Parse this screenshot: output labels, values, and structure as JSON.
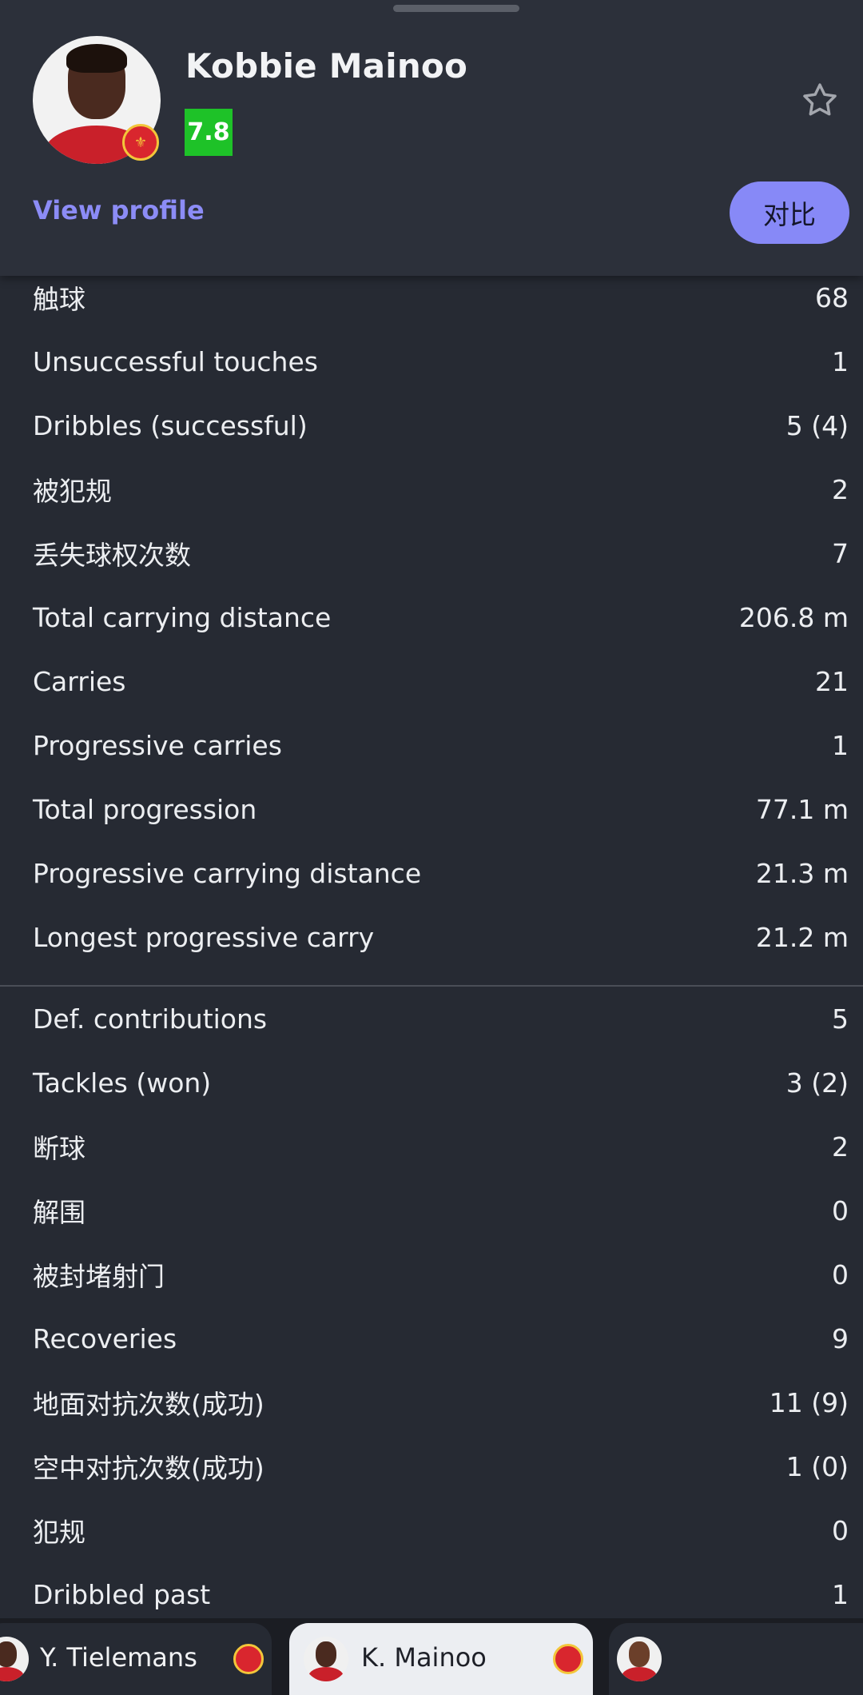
{
  "header": {
    "player_name": "Kobbie Mainoo",
    "rating": "7.8",
    "view_profile_label": "View profile",
    "compare_label": "对比",
    "favorite_icon": "star-outline-icon"
  },
  "stats_group_1": [
    {
      "label": "触球",
      "value": "68"
    },
    {
      "label": "Unsuccessful touches",
      "value": "1"
    },
    {
      "label": "Dribbles (successful)",
      "value": "5 (4)"
    },
    {
      "label": "被犯规",
      "value": "2"
    },
    {
      "label": "丢失球权次数",
      "value": "7"
    },
    {
      "label": "Total carrying distance",
      "value": "206.8 m"
    },
    {
      "label": "Carries",
      "value": "21"
    },
    {
      "label": "Progressive carries",
      "value": "1"
    },
    {
      "label": "Total progression",
      "value": "77.1 m"
    },
    {
      "label": "Progressive carrying distance",
      "value": "21.3 m"
    },
    {
      "label": "Longest progressive carry",
      "value": "21.2 m"
    }
  ],
  "stats_group_2": [
    {
      "label": "Def. contributions",
      "value": "5"
    },
    {
      "label": "Tackles (won)",
      "value": "3 (2)"
    },
    {
      "label": "断球",
      "value": "2"
    },
    {
      "label": "解围",
      "value": "0"
    },
    {
      "label": "被封堵射门",
      "value": "0"
    },
    {
      "label": "Recoveries",
      "value": "9"
    },
    {
      "label": "地面对抗次数(成功)",
      "value": "11 (9)"
    },
    {
      "label": "空中对抗次数(成功)",
      "value": "1 (0)"
    },
    {
      "label": "犯规",
      "value": "0"
    },
    {
      "label": "Dribbled past",
      "value": "1"
    }
  ],
  "player_tabs": [
    {
      "name": "Y. Tielemans"
    },
    {
      "name": "K. Mainoo"
    },
    {
      "name": ""
    }
  ],
  "colors": {
    "accent": "#8789f7",
    "rating": "#1ec228",
    "background": "#262a33",
    "header": "#2c303a"
  }
}
